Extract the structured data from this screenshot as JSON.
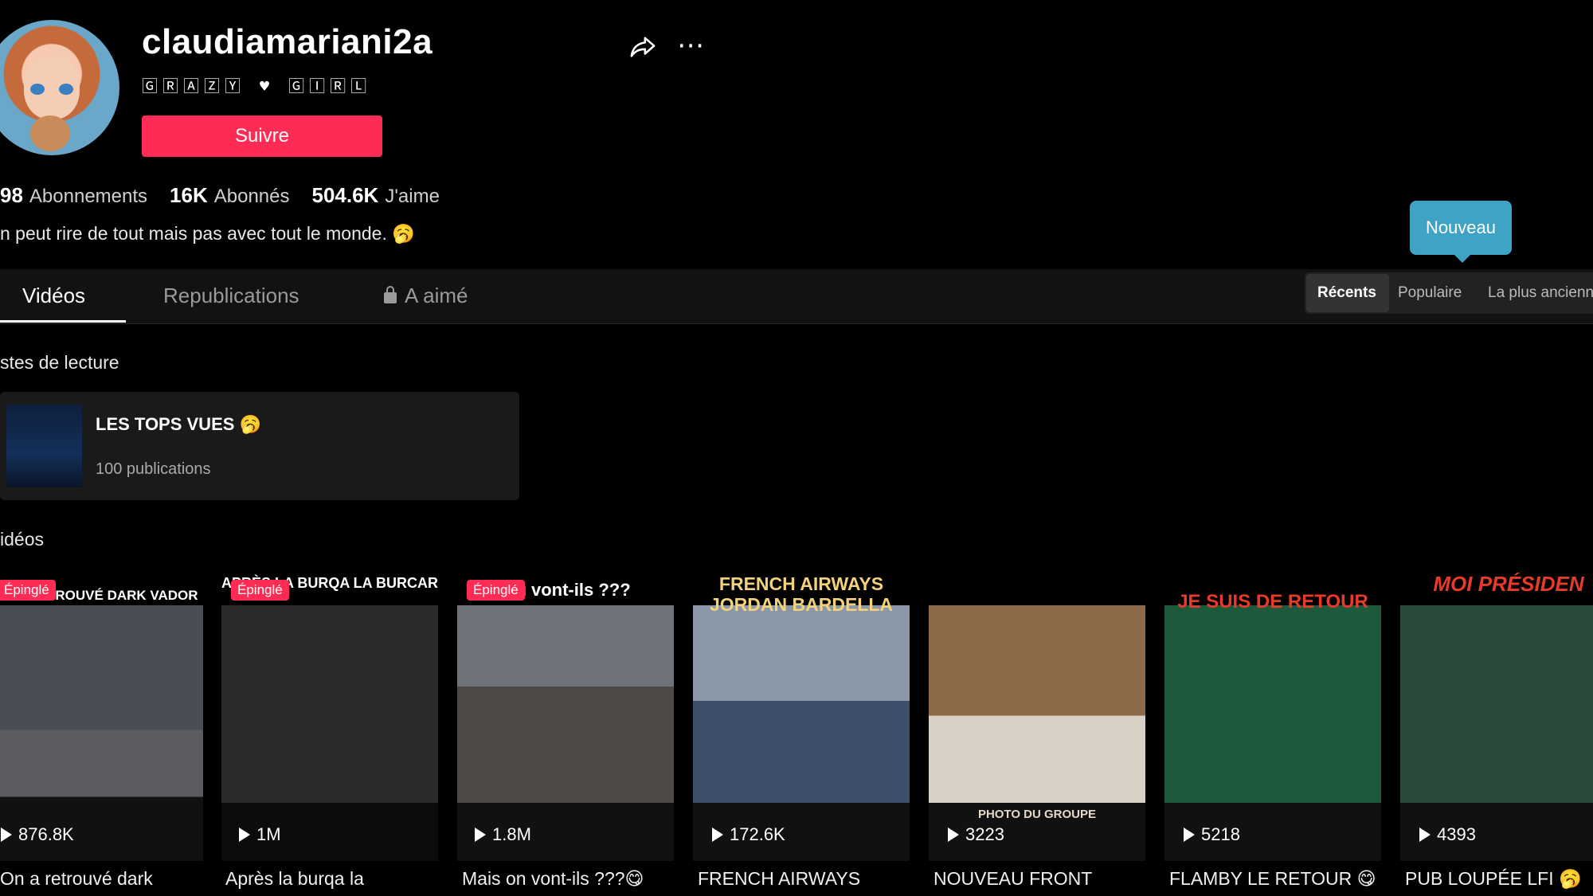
{
  "profile": {
    "username": "claudiamariani2a",
    "nickname": "🄶🅁🄰🅉🅈 ♥ 🄶🄸🅁🄻",
    "follow_label": "Suivre",
    "stats": [
      {
        "value": "98",
        "label": "Abonnements"
      },
      {
        "value": "16K",
        "label": "Abonnés"
      },
      {
        "value": "504.6K",
        "label": "J'aime"
      }
    ],
    "bio": "n peut rire de tout mais pas avec tout le monde. 🥱"
  },
  "tooltip": "Nouveau",
  "tabs": [
    {
      "label": "Vidéos"
    },
    {
      "label": "Republications"
    },
    {
      "label": "A aimé"
    }
  ],
  "sort": [
    {
      "label": "Récents"
    },
    {
      "label": "Populaire"
    },
    {
      "label": "La plus ancienn"
    }
  ],
  "sections": {
    "playlists_title": "stes de lecture",
    "videos_title": "idéos"
  },
  "playlist": {
    "title": "LES TOPS VUES 🥱",
    "count": "100 publications"
  },
  "videos": [
    {
      "pinned": "Épinglé",
      "overlay": "ON A RETROUVÉ DARK VADOR",
      "views": "876.8K",
      "caption": "On a retrouvé dark"
    },
    {
      "pinned": "Épinglé",
      "overlay": "APRÈS LA BURQA LA BURCAR",
      "views": "1M",
      "caption": "Après la burqa la"
    },
    {
      "pinned": "Épinglé",
      "overlay": "où vont-ils ???",
      "views": "1.8M",
      "caption": "Mais on vont-ils ???😋"
    },
    {
      "pinned": "",
      "overlay": "FRENCH AIRWAYS JORDAN BARDELLA",
      "views": "172.6K",
      "caption": "FRENCH AIRWAYS"
    },
    {
      "pinned": "",
      "overlay": "PHOTO DU GROUPE",
      "views": "3223",
      "caption": "NOUVEAU FRONT"
    },
    {
      "pinned": "",
      "overlay": "JE SUIS DE RETOUR",
      "views": "5218",
      "caption": "FLAMBY LE RETOUR 😋"
    },
    {
      "pinned": "",
      "overlay": "MOI PRÉSIDEN",
      "views": "4393",
      "caption": "PUB LOUPÉE LFI 🥱"
    }
  ],
  "colors": {
    "accent": "#fe2c55",
    "tooltip": "#3fa3c6",
    "background": "#000000"
  }
}
